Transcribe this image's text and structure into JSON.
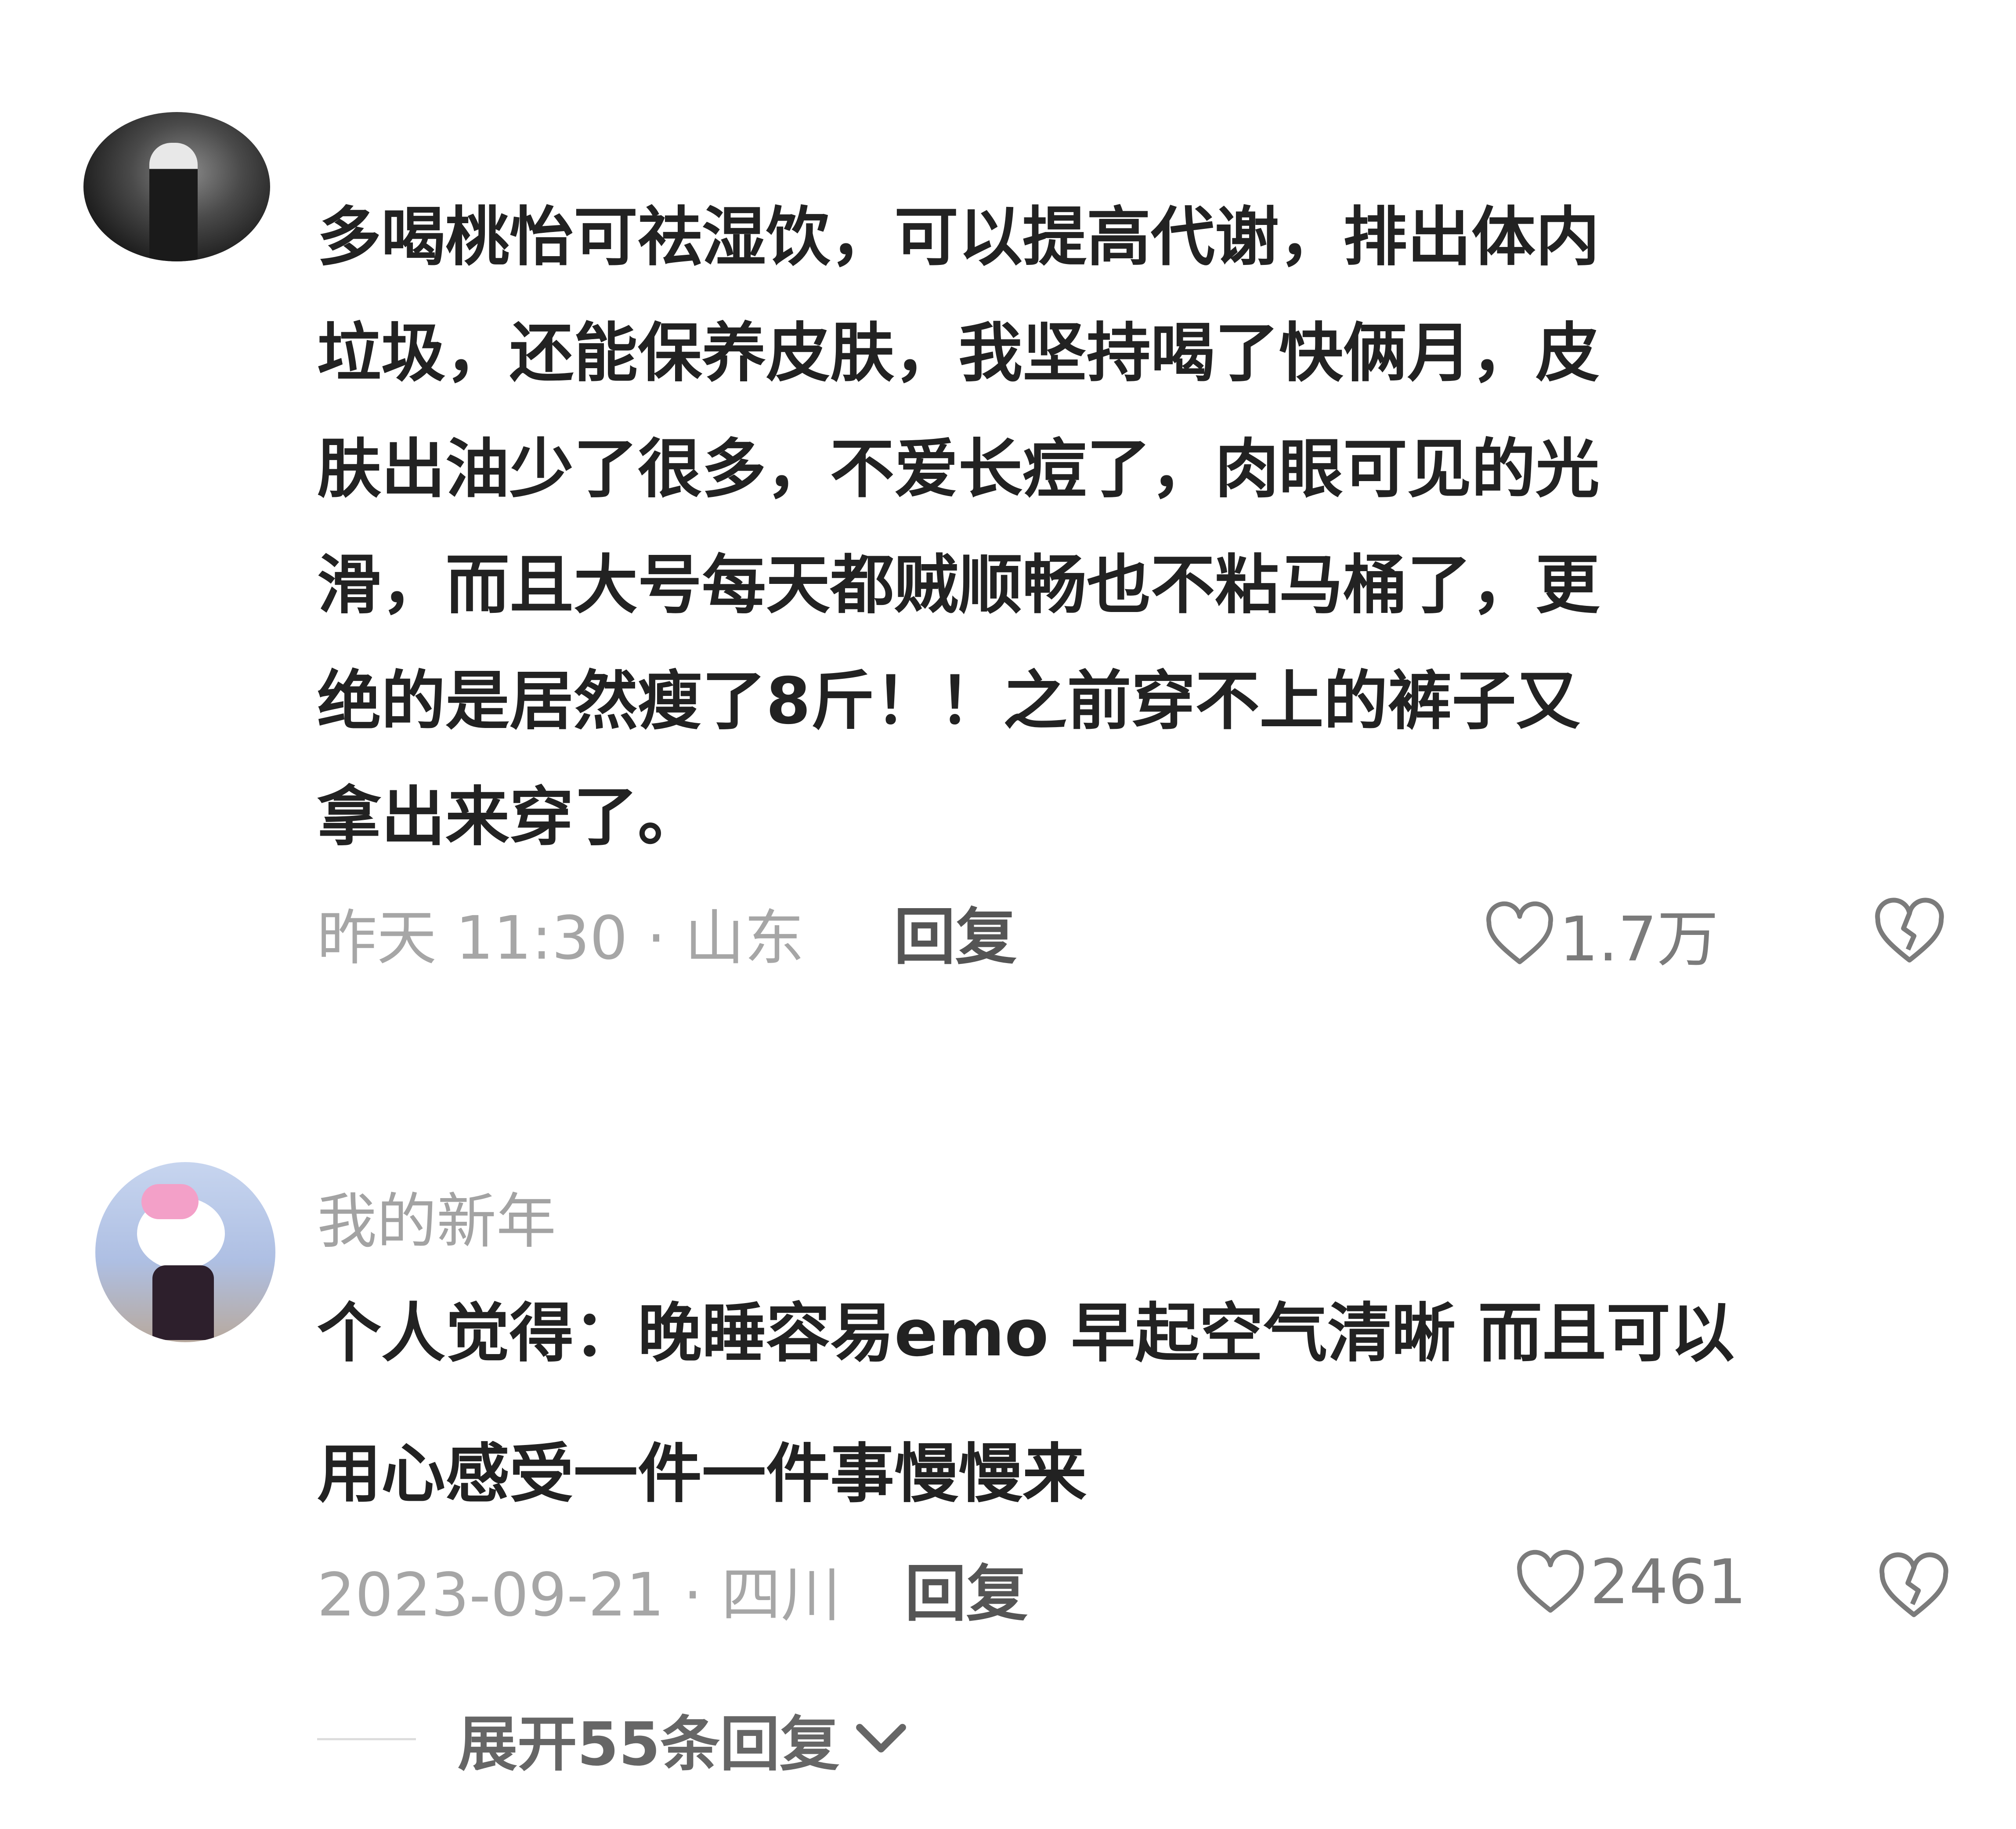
{
  "comments": [
    {
      "username": "",
      "text": "多喝桃怡可祛湿饮，可以提高代谢，排出体内\n垃圾，还能保养皮肤，我坚持喝了快俩月，皮\n肤出油少了很多，不爱长痘了，肉眼可见的光\n滑，而且大号每天都贼顺畅也不粘马桶了，更\n绝的是居然瘦了8斤！！之前穿不上的裤子又\n拿出来穿了。",
      "meta": "昨天 11:30 · 山东",
      "reply_label": "回复",
      "likes": "1.7万"
    },
    {
      "username": "我的新年",
      "text": "个人觉得：晚睡容易emo  早起空气清晰 而且可以\n用心感受一件一件事慢慢来",
      "meta": "2023-09-21 · 四川",
      "reply_label": "回复",
      "likes": "2461"
    }
  ],
  "expand_replies": "展开55条回复",
  "icons": {
    "like": "heart-outline-icon",
    "dislike": "broken-heart-icon",
    "expand": "chevron-down-icon"
  },
  "colors": {
    "text": "#222222",
    "meta": "#a6a6a6",
    "icon": "#7b7b7b"
  }
}
